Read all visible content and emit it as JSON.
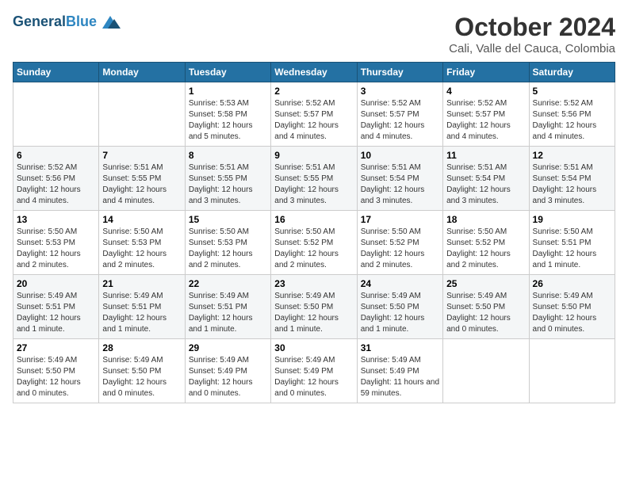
{
  "logo": {
    "line1": "General",
    "line2": "Blue"
  },
  "title": "October 2024",
  "location": "Cali, Valle del Cauca, Colombia",
  "days_of_week": [
    "Sunday",
    "Monday",
    "Tuesday",
    "Wednesday",
    "Thursday",
    "Friday",
    "Saturday"
  ],
  "weeks": [
    [
      {
        "day": "",
        "info": ""
      },
      {
        "day": "",
        "info": ""
      },
      {
        "day": "1",
        "info": "Sunrise: 5:53 AM\nSunset: 5:58 PM\nDaylight: 12 hours and 5 minutes."
      },
      {
        "day": "2",
        "info": "Sunrise: 5:52 AM\nSunset: 5:57 PM\nDaylight: 12 hours and 4 minutes."
      },
      {
        "day": "3",
        "info": "Sunrise: 5:52 AM\nSunset: 5:57 PM\nDaylight: 12 hours and 4 minutes."
      },
      {
        "day": "4",
        "info": "Sunrise: 5:52 AM\nSunset: 5:57 PM\nDaylight: 12 hours and 4 minutes."
      },
      {
        "day": "5",
        "info": "Sunrise: 5:52 AM\nSunset: 5:56 PM\nDaylight: 12 hours and 4 minutes."
      }
    ],
    [
      {
        "day": "6",
        "info": "Sunrise: 5:52 AM\nSunset: 5:56 PM\nDaylight: 12 hours and 4 minutes."
      },
      {
        "day": "7",
        "info": "Sunrise: 5:51 AM\nSunset: 5:55 PM\nDaylight: 12 hours and 4 minutes."
      },
      {
        "day": "8",
        "info": "Sunrise: 5:51 AM\nSunset: 5:55 PM\nDaylight: 12 hours and 3 minutes."
      },
      {
        "day": "9",
        "info": "Sunrise: 5:51 AM\nSunset: 5:55 PM\nDaylight: 12 hours and 3 minutes."
      },
      {
        "day": "10",
        "info": "Sunrise: 5:51 AM\nSunset: 5:54 PM\nDaylight: 12 hours and 3 minutes."
      },
      {
        "day": "11",
        "info": "Sunrise: 5:51 AM\nSunset: 5:54 PM\nDaylight: 12 hours and 3 minutes."
      },
      {
        "day": "12",
        "info": "Sunrise: 5:51 AM\nSunset: 5:54 PM\nDaylight: 12 hours and 3 minutes."
      }
    ],
    [
      {
        "day": "13",
        "info": "Sunrise: 5:50 AM\nSunset: 5:53 PM\nDaylight: 12 hours and 2 minutes."
      },
      {
        "day": "14",
        "info": "Sunrise: 5:50 AM\nSunset: 5:53 PM\nDaylight: 12 hours and 2 minutes."
      },
      {
        "day": "15",
        "info": "Sunrise: 5:50 AM\nSunset: 5:53 PM\nDaylight: 12 hours and 2 minutes."
      },
      {
        "day": "16",
        "info": "Sunrise: 5:50 AM\nSunset: 5:52 PM\nDaylight: 12 hours and 2 minutes."
      },
      {
        "day": "17",
        "info": "Sunrise: 5:50 AM\nSunset: 5:52 PM\nDaylight: 12 hours and 2 minutes."
      },
      {
        "day": "18",
        "info": "Sunrise: 5:50 AM\nSunset: 5:52 PM\nDaylight: 12 hours and 2 minutes."
      },
      {
        "day": "19",
        "info": "Sunrise: 5:50 AM\nSunset: 5:51 PM\nDaylight: 12 hours and 1 minute."
      }
    ],
    [
      {
        "day": "20",
        "info": "Sunrise: 5:49 AM\nSunset: 5:51 PM\nDaylight: 12 hours and 1 minute."
      },
      {
        "day": "21",
        "info": "Sunrise: 5:49 AM\nSunset: 5:51 PM\nDaylight: 12 hours and 1 minute."
      },
      {
        "day": "22",
        "info": "Sunrise: 5:49 AM\nSunset: 5:51 PM\nDaylight: 12 hours and 1 minute."
      },
      {
        "day": "23",
        "info": "Sunrise: 5:49 AM\nSunset: 5:50 PM\nDaylight: 12 hours and 1 minute."
      },
      {
        "day": "24",
        "info": "Sunrise: 5:49 AM\nSunset: 5:50 PM\nDaylight: 12 hours and 1 minute."
      },
      {
        "day": "25",
        "info": "Sunrise: 5:49 AM\nSunset: 5:50 PM\nDaylight: 12 hours and 0 minutes."
      },
      {
        "day": "26",
        "info": "Sunrise: 5:49 AM\nSunset: 5:50 PM\nDaylight: 12 hours and 0 minutes."
      }
    ],
    [
      {
        "day": "27",
        "info": "Sunrise: 5:49 AM\nSunset: 5:50 PM\nDaylight: 12 hours and 0 minutes."
      },
      {
        "day": "28",
        "info": "Sunrise: 5:49 AM\nSunset: 5:50 PM\nDaylight: 12 hours and 0 minutes."
      },
      {
        "day": "29",
        "info": "Sunrise: 5:49 AM\nSunset: 5:49 PM\nDaylight: 12 hours and 0 minutes."
      },
      {
        "day": "30",
        "info": "Sunrise: 5:49 AM\nSunset: 5:49 PM\nDaylight: 12 hours and 0 minutes."
      },
      {
        "day": "31",
        "info": "Sunrise: 5:49 AM\nSunset: 5:49 PM\nDaylight: 11 hours and 59 minutes."
      },
      {
        "day": "",
        "info": ""
      },
      {
        "day": "",
        "info": ""
      }
    ]
  ]
}
